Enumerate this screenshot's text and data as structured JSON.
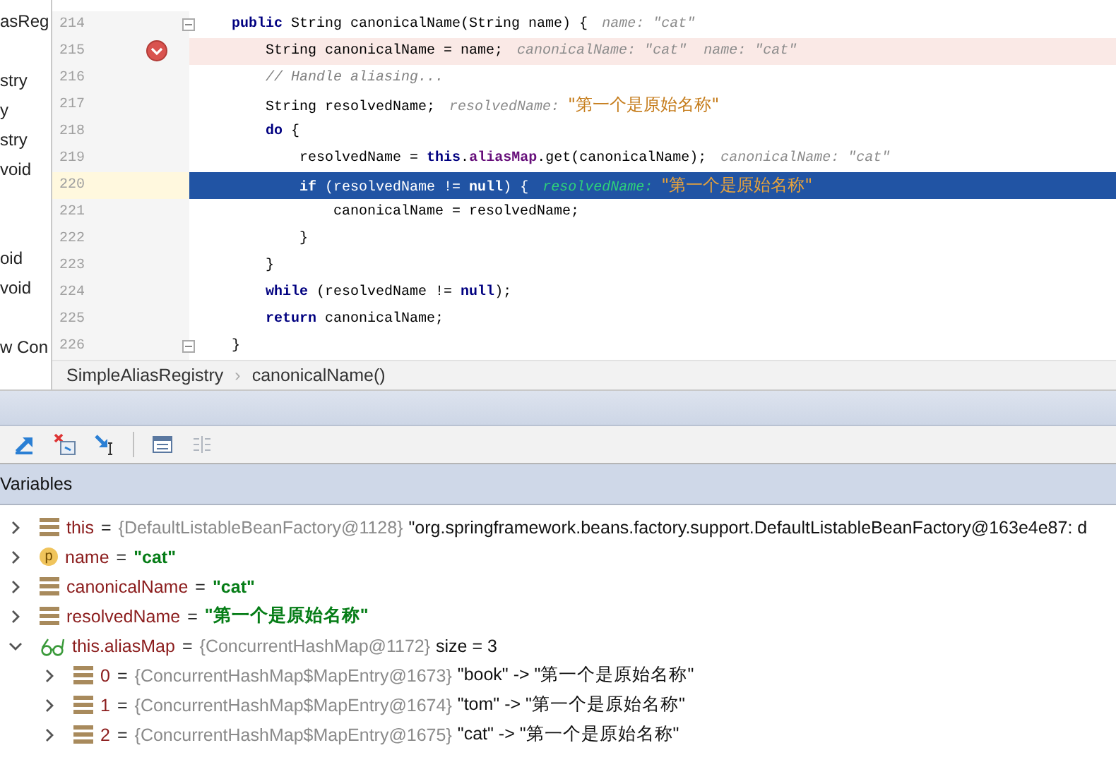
{
  "project_panel": {
    "items": [
      "asReg",
      "stry",
      "y",
      "stry",
      "void",
      "oid",
      "void",
      "w Con"
    ]
  },
  "editor": {
    "lines": [
      {
        "number": "214",
        "breakpoint": false,
        "current": false,
        "fold": true,
        "tokens": [
          {
            "kind": "keyword",
            "text": "    public"
          },
          {
            "kind": "plain",
            "text": " String canonicalName(String name) {"
          },
          {
            "kind": "hint",
            "text": "name: "
          },
          {
            "kind": "hint",
            "text": "\"cat\""
          }
        ]
      },
      {
        "number": "215",
        "breakpoint": true,
        "current": false,
        "fold": false,
        "tokens": [
          {
            "kind": "plain",
            "text": "        String canonicalName = name;"
          },
          {
            "kind": "hint",
            "text": "canonicalName: \"cat\"  name: \"cat\""
          }
        ]
      },
      {
        "number": "216",
        "breakpoint": false,
        "current": false,
        "fold": false,
        "tokens": [
          {
            "kind": "comment",
            "text": "        // Handle aliasing..."
          }
        ]
      },
      {
        "number": "217",
        "breakpoint": false,
        "current": false,
        "fold": false,
        "tokens": [
          {
            "kind": "plain",
            "text": "        String resolvedName;"
          },
          {
            "kind": "hint",
            "text": "resolvedName: "
          },
          {
            "kind": "hint-value",
            "text": "\"第一个是原始名称\""
          }
        ]
      },
      {
        "number": "218",
        "breakpoint": false,
        "current": false,
        "fold": false,
        "tokens": [
          {
            "kind": "keyword",
            "text": "        do"
          },
          {
            "kind": "plain",
            "text": " {"
          }
        ]
      },
      {
        "number": "219",
        "breakpoint": false,
        "current": false,
        "fold": false,
        "tokens": [
          {
            "kind": "plain",
            "text": "            resolvedName = "
          },
          {
            "kind": "keyword",
            "text": "this"
          },
          {
            "kind": "plain",
            "text": "."
          },
          {
            "kind": "field",
            "text": "aliasMap"
          },
          {
            "kind": "plain",
            "text": ".get(canonicalName);"
          },
          {
            "kind": "hint",
            "text": "canonicalName: \"cat\""
          }
        ]
      },
      {
        "number": "220",
        "breakpoint": false,
        "current": true,
        "fold": false,
        "tokens": [
          {
            "kind": "keyword",
            "text": "            if"
          },
          {
            "kind": "plain",
            "text": " (resolvedName != "
          },
          {
            "kind": "keyword",
            "text": "null"
          },
          {
            "kind": "plain",
            "text": ") {"
          },
          {
            "kind": "hint",
            "text": "resolvedName: "
          },
          {
            "kind": "hint-value",
            "text": "\"第一个是原始名称\""
          }
        ]
      },
      {
        "number": "221",
        "breakpoint": false,
        "current": false,
        "fold": false,
        "tokens": [
          {
            "kind": "plain",
            "text": "                canonicalName = resolvedName;"
          }
        ]
      },
      {
        "number": "222",
        "breakpoint": false,
        "current": false,
        "fold": false,
        "tokens": [
          {
            "kind": "plain",
            "text": "            }"
          }
        ]
      },
      {
        "number": "223",
        "breakpoint": false,
        "current": false,
        "fold": false,
        "tokens": [
          {
            "kind": "plain",
            "text": "        }"
          }
        ]
      },
      {
        "number": "224",
        "breakpoint": false,
        "current": false,
        "fold": false,
        "tokens": [
          {
            "kind": "keyword",
            "text": "        while"
          },
          {
            "kind": "plain",
            "text": " (resolvedName != "
          },
          {
            "kind": "keyword",
            "text": "null"
          },
          {
            "kind": "plain",
            "text": ");"
          }
        ]
      },
      {
        "number": "225",
        "breakpoint": false,
        "current": false,
        "fold": false,
        "tokens": [
          {
            "kind": "keyword",
            "text": "        return"
          },
          {
            "kind": "plain",
            "text": " canonicalName;"
          }
        ]
      },
      {
        "number": "226",
        "breakpoint": false,
        "current": false,
        "fold": true,
        "tokens": [
          {
            "kind": "plain",
            "text": "    }"
          }
        ]
      }
    ]
  },
  "breadcrumb": [
    "SimpleAliasRegistry",
    "›",
    "canonicalName()"
  ],
  "variables": {
    "title": "Variables",
    "rows": [
      {
        "kind": "field",
        "expanded": false,
        "name": "this",
        "type": "{DefaultListableBeanFactory@1128}",
        "value": "\"org.springframework.beans.factory.support.DefaultListableBeanFactory@163e4e87: d",
        "string_value": false,
        "separator": "="
      },
      {
        "kind": "param",
        "badge": "p",
        "expanded": false,
        "name": "name",
        "value": "\"cat\"",
        "string_value": true,
        "separator": "="
      },
      {
        "kind": "field",
        "expanded": false,
        "name": "canonicalName",
        "value": "\"cat\"",
        "string_value": true,
        "separator": "="
      },
      {
        "kind": "field",
        "expanded": false,
        "name": "resolvedName",
        "value": "\"第一个是原始名称\"",
        "string_value": true,
        "separator": "="
      },
      {
        "kind": "watch",
        "expanded": true,
        "name": "this.aliasMap",
        "type": "{ConcurrentHashMap@1172}",
        "value": "size = 3",
        "string_value": false,
        "separator": "=",
        "children": [
          {
            "kind": "field",
            "expanded": false,
            "name": "0",
            "type": "{ConcurrentHashMap$MapEntry@1673}",
            "value": "\"book\" -> \"第一个是原始名称\"",
            "string_value": false,
            "separator": "="
          },
          {
            "kind": "field",
            "expanded": false,
            "name": "1",
            "type": "{ConcurrentHashMap$MapEntry@1674}",
            "value": "\"tom\" -> \"第一个是原始名称\"",
            "string_value": false,
            "separator": "="
          },
          {
            "kind": "field",
            "expanded": false,
            "name": "2",
            "type": "{ConcurrentHashMap$MapEntry@1675}",
            "value": "\"cat\" -> \"第一个是原始名称\"",
            "string_value": false,
            "separator": "="
          }
        ]
      }
    ]
  }
}
